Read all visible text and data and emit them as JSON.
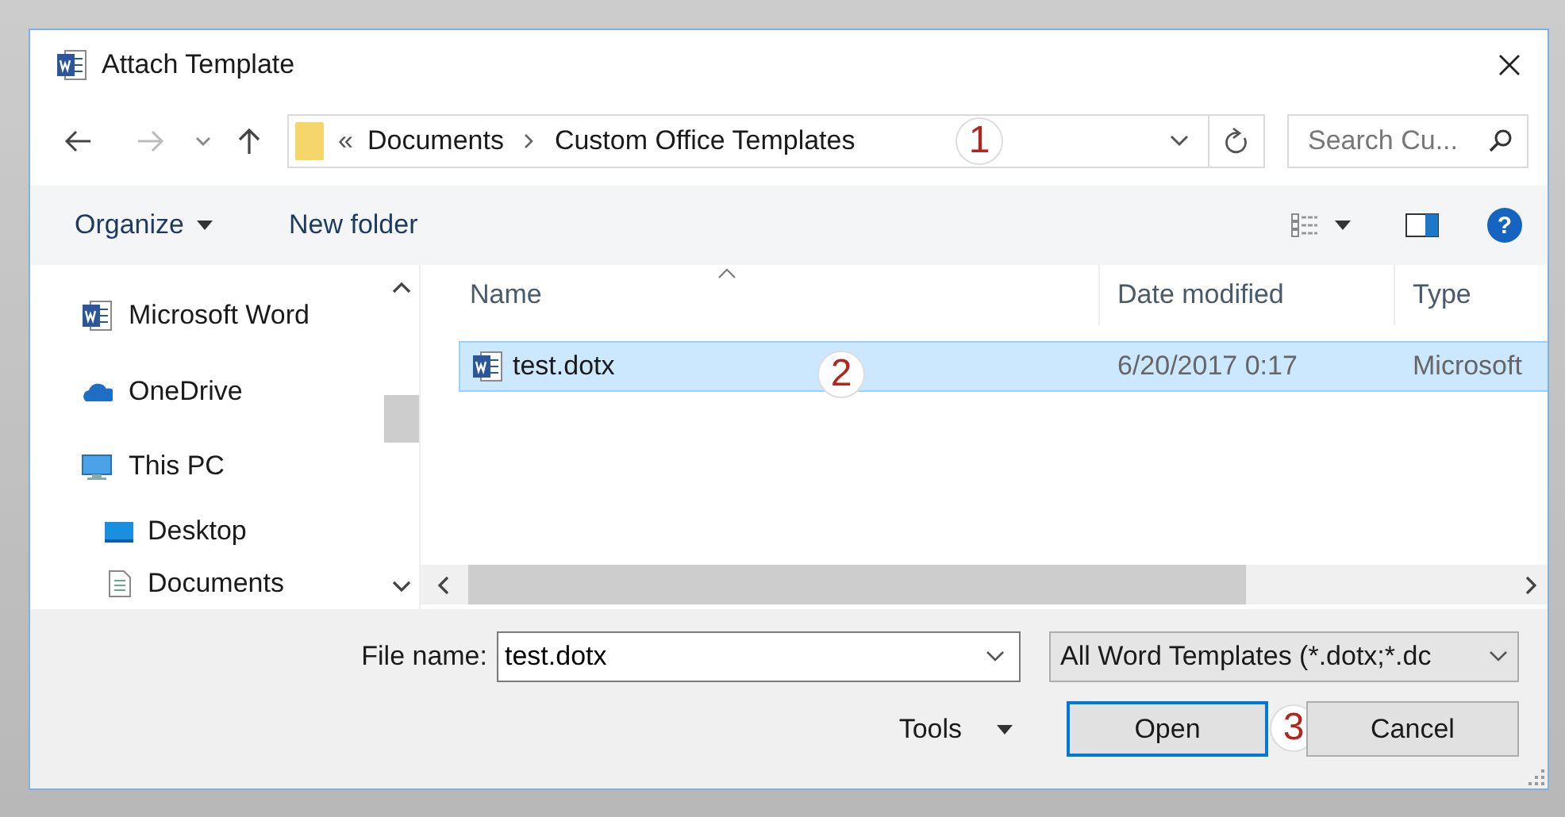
{
  "window": {
    "title": "Attach Template"
  },
  "address_bar": {
    "overflow": "«",
    "path": [
      "Documents",
      "Custom Office Templates"
    ],
    "callout": "1"
  },
  "search": {
    "placeholder": "Search Cu..."
  },
  "toolbar": {
    "buttons": [
      {
        "label": "Organize",
        "menu": true
      },
      {
        "label": "New folder",
        "menu": false
      }
    ],
    "help": "?"
  },
  "nav_pane": {
    "items": [
      {
        "label": "Microsoft Word",
        "kind": "word"
      },
      {
        "label": "OneDrive",
        "kind": "cloud"
      },
      {
        "label": "This PC",
        "kind": "pc",
        "children": [
          {
            "label": "Desktop",
            "kind": "desktop"
          },
          {
            "label": "Documents",
            "kind": "documents"
          }
        ]
      }
    ]
  },
  "file_list": {
    "columns": [
      "Name",
      "Date modified",
      "Type"
    ],
    "rows": [
      {
        "name": "test.dotx",
        "date": "6/20/2017 0:17",
        "type": "Microsoft",
        "selected": true,
        "callout": "2"
      }
    ]
  },
  "file_name": {
    "label": "File name:",
    "value": "test.dotx"
  },
  "file_type": {
    "value": "All Word Templates (*.dotx;*.dc"
  },
  "buttons": [
    {
      "label": "Tools",
      "kind": "menu"
    },
    {
      "label": "Open",
      "kind": "default",
      "callout": "3"
    },
    {
      "label": "Cancel",
      "kind": "normal"
    }
  ]
}
